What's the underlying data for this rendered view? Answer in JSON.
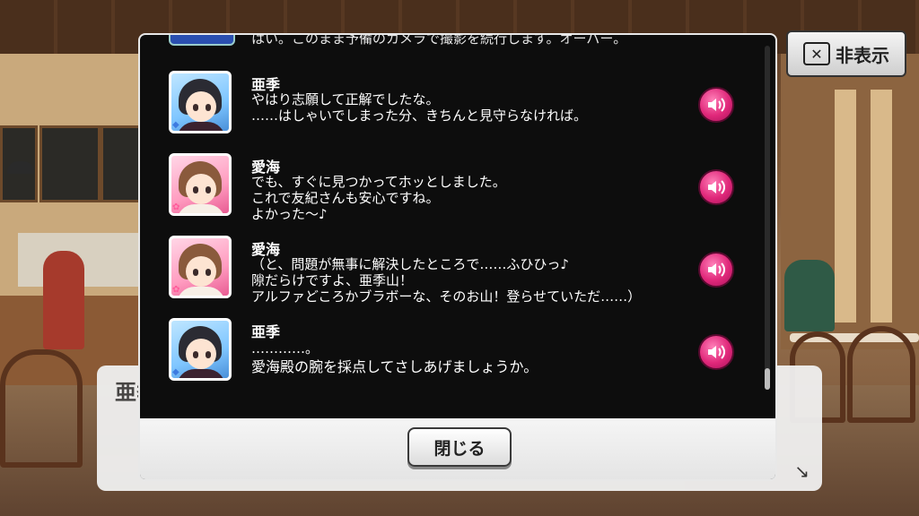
{
  "top_bar": {
    "hide_label": "非表示"
  },
  "behind_dialog": {
    "speaker": "亜季"
  },
  "log": {
    "partial_line": "はい。このまま予備のカメラで撮影を続行します。オーバー。",
    "entries": [
      {
        "speaker": "亜季",
        "avatar_type": "cool",
        "lines": [
          "やはり志願して正解でしたな。",
          "……はしゃいでしまった分、きちんと見守らなければ。"
        ]
      },
      {
        "speaker": "愛海",
        "avatar_type": "cute",
        "lines": [
          "でも、すぐに見つかってホッとしました。",
          "これで友紀さんも安心ですね。",
          "よかった～♪"
        ]
      },
      {
        "speaker": "愛海",
        "avatar_type": "cute",
        "lines": [
          "（と、問題が無事に解決したところで……ふひひっ♪",
          "隙だらけですよ、亜季山！",
          "アルファどころかブラボーな、そのお山！登らせていただ……）"
        ]
      },
      {
        "speaker": "亜季",
        "avatar_type": "cool",
        "lines": [
          "…………。",
          "愛海殿の腕を採点してさしあげましょうか。"
        ]
      }
    ]
  },
  "footer": {
    "close_label": "閉じる"
  },
  "colors": {
    "voice_button": "#e0287a",
    "panel_bg": "#0d0d0d"
  }
}
